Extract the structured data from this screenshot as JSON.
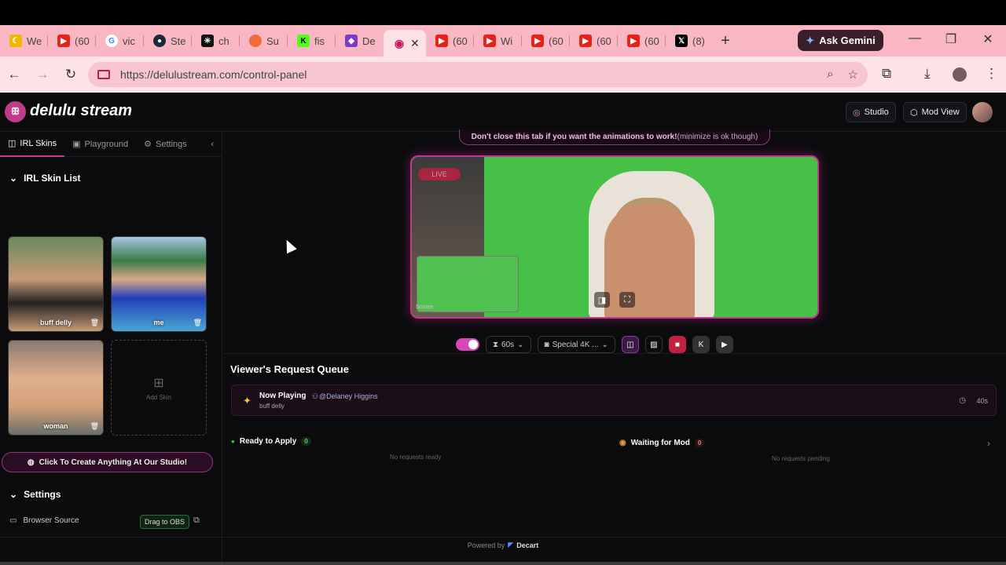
{
  "browser": {
    "tabs": [
      {
        "title": "We",
        "icon": "moon-icon",
        "color": "#f2b705"
      },
      {
        "title": "(60",
        "icon": "youtube-icon",
        "color": "#e62117"
      },
      {
        "title": "vic",
        "icon": "google-icon",
        "color": "#4285f4"
      },
      {
        "title": "Ste",
        "icon": "steam-icon",
        "color": "#1b2838"
      },
      {
        "title": "ch",
        "icon": "chatgpt-icon",
        "color": "#111111"
      },
      {
        "title": "Su",
        "icon": "circle-icon",
        "color": "#f26b3a"
      },
      {
        "title": "fis",
        "icon": "kick-icon",
        "color": "#53fc18"
      },
      {
        "title": "De",
        "icon": "decart-icon",
        "color": "#7a3cc8"
      },
      {
        "title": "(60",
        "icon": "youtube-icon",
        "color": "#e62117"
      },
      {
        "title": "Wi",
        "icon": "youtube-icon",
        "color": "#e62117"
      },
      {
        "title": "(60",
        "icon": "youtube-icon",
        "color": "#e62117"
      },
      {
        "title": "(60",
        "icon": "youtube-icon",
        "color": "#e62117"
      },
      {
        "title": "(60",
        "icon": "youtube-icon",
        "color": "#e62117"
      },
      {
        "title": "(8)",
        "icon": "x-icon",
        "color": "#000000"
      }
    ],
    "active_tab_icon": "record-icon",
    "gemini_label": "Ask Gemini",
    "url": "https://delulustream.com/control-panel"
  },
  "app": {
    "brand": "delulu stream",
    "studio_label": "Studio",
    "mod_view_label": "Mod View",
    "sidebar": {
      "tabs": [
        "IRL Skins",
        "Playground",
        "Settings"
      ],
      "skin_list_title": "IRL Skin List",
      "skins": [
        "buff delly",
        "me",
        "woman"
      ],
      "add_skin_label": "Add Skin",
      "create_label": "Click To Create Anything At Our Studio!",
      "settings_title": "Settings",
      "browser_source_label": "Browser Source",
      "drag_obs_label": "Drag to OBS"
    },
    "notice_bold": "Don't close this tab if you want the animations to work!",
    "notice_rest": " (minimize is ok though)",
    "live_badge": "LIVE",
    "source_label": "Source",
    "controls": {
      "duration": "60s",
      "model": "Special 4K ..."
    },
    "queue": {
      "title": "Viewer's Request Queue",
      "now_playing_label": "Now Playing",
      "requester": "@Delaney Higgins",
      "now_playing_skin": "buff delly",
      "now_playing_time": "40s",
      "ready_label": "Ready to Apply",
      "ready_count": "0",
      "ready_empty": "No requests ready",
      "waiting_label": "Waiting for Mod",
      "waiting_count": "0",
      "waiting_empty": "No requests pending"
    },
    "footer_powered": "Powered by",
    "footer_brand": "Decart"
  },
  "colors": {
    "accent": "#c13b8a",
    "tabstrip": "#f9b7c4",
    "background": "#0b0b0d"
  }
}
